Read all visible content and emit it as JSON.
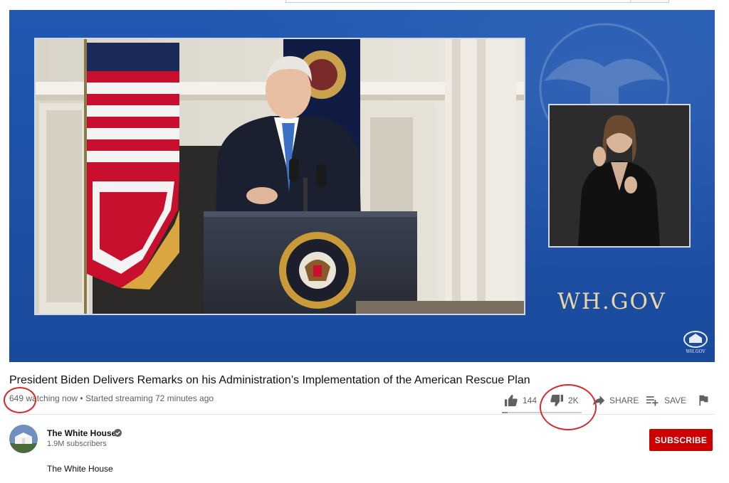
{
  "video": {
    "title": "President Biden Delivers Remarks on his Administration’s Implementation of the American Rescue Plan",
    "watching_count": "649",
    "watching_rest": " watching now • Started streaming 72 minutes ago",
    "overlay_text": "WH.GOV",
    "overlay_small": "WH.GOV"
  },
  "actions": {
    "likes": "144",
    "dislikes": "2K",
    "share_label": "SHARE",
    "save_label": "SAVE",
    "like_fraction": 0.07
  },
  "channel": {
    "name": "The White House",
    "subscribers": "1.9M subscribers",
    "subscribe_label": "SUBSCRIBE",
    "description": "The White House"
  },
  "colors": {
    "accent": "#cc0000",
    "player_bg": "#1d4fa3",
    "annotation": "#d42a2a"
  },
  "icons": [
    "thumb-up-icon",
    "thumb-down-icon",
    "share-icon",
    "add-to-playlist-icon",
    "flag-icon",
    "verified-icon"
  ]
}
